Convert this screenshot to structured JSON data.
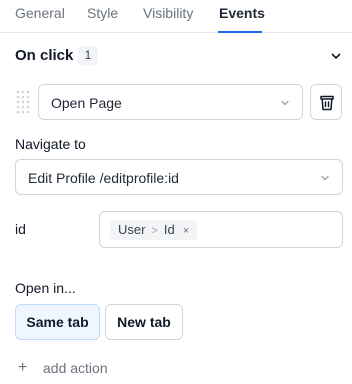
{
  "tabs": [
    {
      "label": "General"
    },
    {
      "label": "Style"
    },
    {
      "label": "Visibility"
    },
    {
      "label": "Events",
      "active": true
    }
  ],
  "event": {
    "title": "On click",
    "count": "1"
  },
  "action": {
    "type": "Open Page"
  },
  "navigate": {
    "label": "Navigate to",
    "value": "Edit Profile /editprofile:id"
  },
  "param": {
    "name": "id",
    "chip_parts": [
      "User",
      "Id"
    ],
    "chip_separator": ">",
    "chip_remove": "×"
  },
  "open_in": {
    "label": "Open in...",
    "options": [
      "Same tab",
      "New tab"
    ],
    "selected": "Same tab"
  },
  "add_action": {
    "label": "add action",
    "icon": "+"
  },
  "colors": {
    "accent": "#2563eb",
    "selected_bg": "#eff6ff"
  }
}
